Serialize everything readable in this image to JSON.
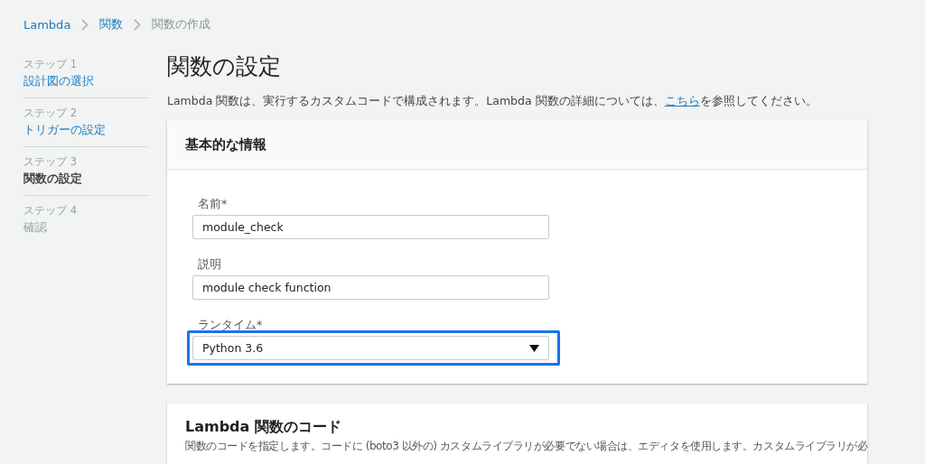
{
  "breadcrumb": [
    {
      "label": "Lambda",
      "link": true
    },
    {
      "label": "関数",
      "link": true
    },
    {
      "label": "関数の作成",
      "link": false
    }
  ],
  "steps": [
    {
      "step": "ステップ 1",
      "label": "設計図の選択",
      "current": false,
      "disabled": false
    },
    {
      "step": "ステップ 2",
      "label": "トリガーの設定",
      "current": false,
      "disabled": false
    },
    {
      "step": "ステップ 3",
      "label": "関数の設定",
      "current": true,
      "disabled": false
    },
    {
      "step": "ステップ 4",
      "label": "確認",
      "current": false,
      "disabled": true
    }
  ],
  "page_title": "関数の設定",
  "intro": {
    "before": "Lambda 関数は、実行するカスタムコードで構成されます。Lambda 関数の詳細については、",
    "link": "こちら",
    "after": "を参照してください。"
  },
  "basic_info": {
    "title": "基本的な情報",
    "fields": [
      {
        "kind": "text",
        "label": "名前*",
        "value": "module_check",
        "focused": false
      },
      {
        "kind": "text",
        "label": "説明",
        "value": "module check function",
        "focused": false
      },
      {
        "kind": "select",
        "label": "ランタイム*",
        "value": "Python 3.6",
        "focused": true
      }
    ]
  },
  "code_section": {
    "title": "Lambda 関数のコード",
    "description": "関数のコードを指定します。コードに (boto3 以外の) カスタムライブラリが必要でない場合は、エディタを使用します。カスタムライブラリが必"
  }
}
